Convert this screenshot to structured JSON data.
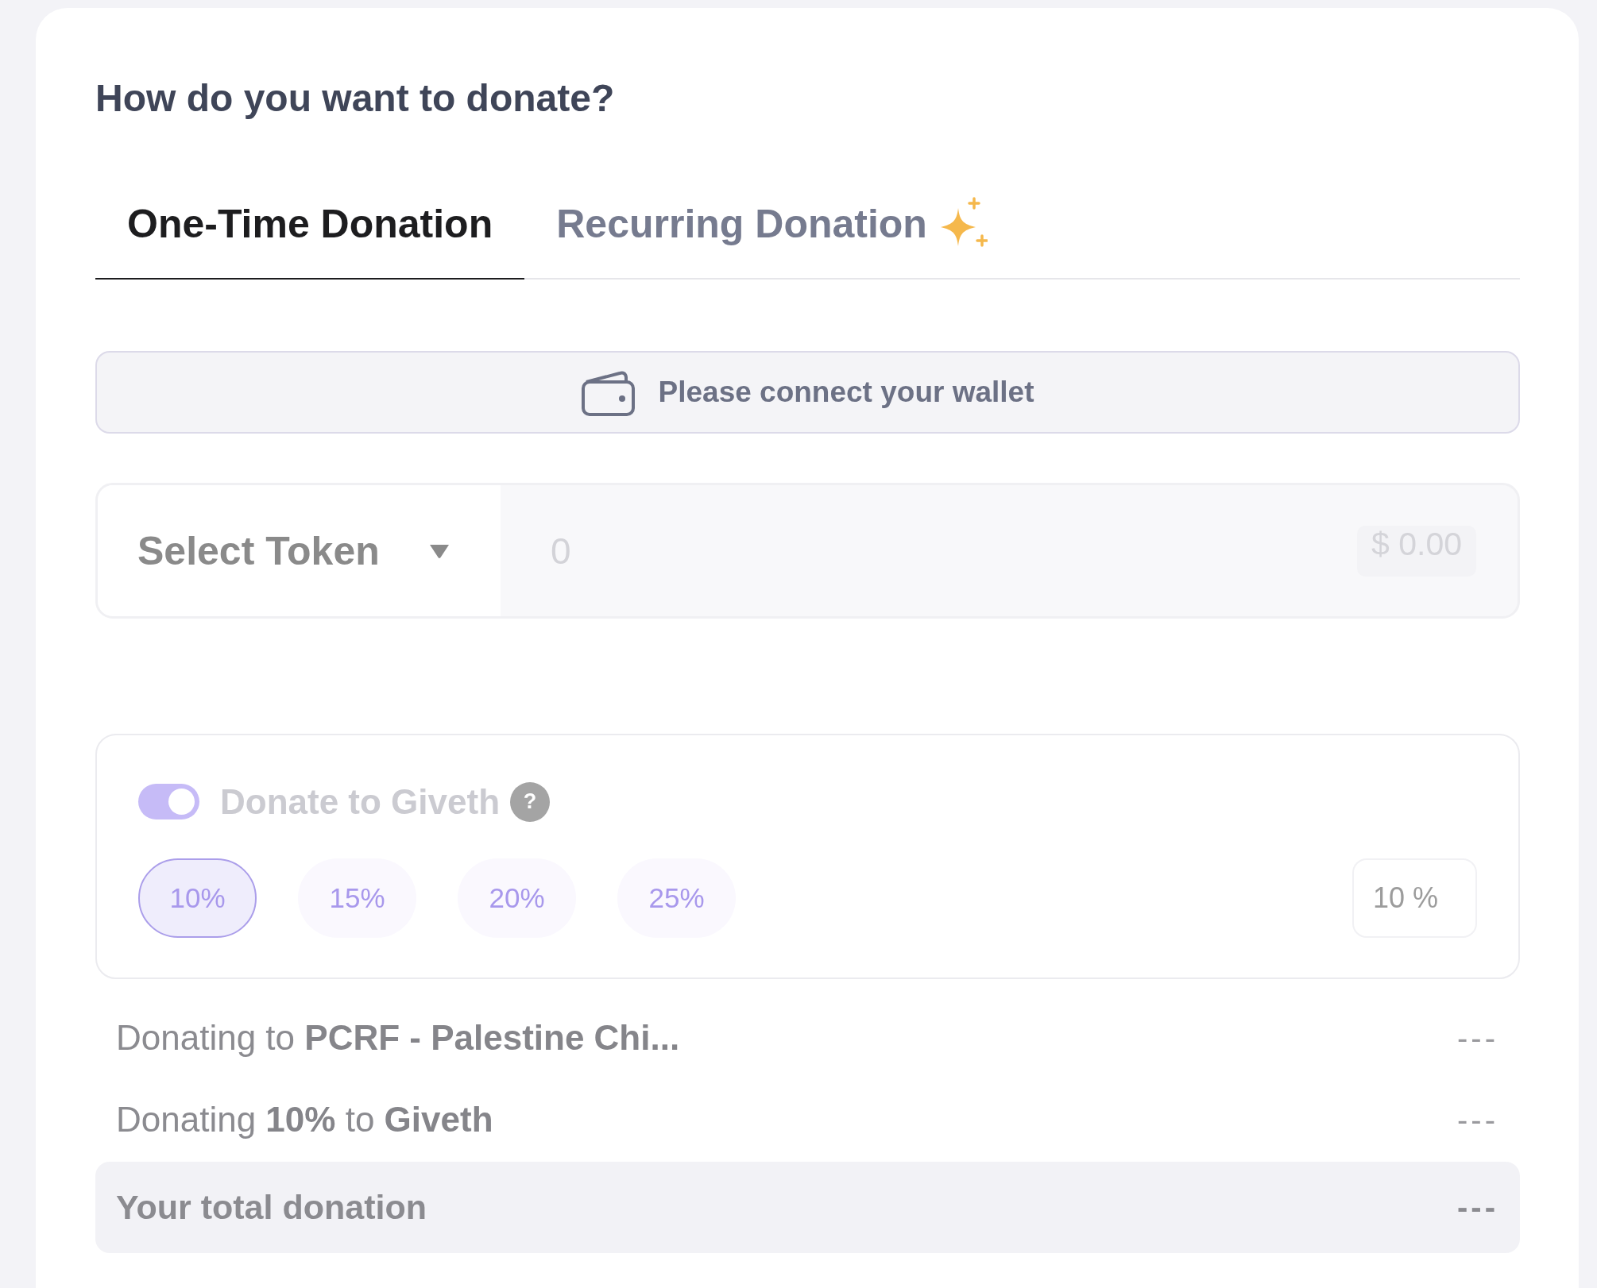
{
  "title": "How do you want to donate?",
  "tabs": [
    {
      "label": "One-Time Donation",
      "selected": true,
      "featured": false
    },
    {
      "label": "Recurring Donation",
      "selected": false,
      "featured": true
    }
  ],
  "wallet_button": {
    "label": "Please connect your wallet"
  },
  "amount": {
    "token_select": "Select Token",
    "amount_field": {
      "placeholder": "0"
    },
    "usd_value": "$ 0.00"
  },
  "giveth_support": {
    "toggle": {
      "label": "Donate to Giveth",
      "on": true
    },
    "help": "?",
    "options": [
      {
        "label": "10%",
        "selected": true
      },
      {
        "label": "15%",
        "selected": false
      },
      {
        "label": "20%",
        "selected": false
      },
      {
        "label": "25%",
        "selected": false
      }
    ],
    "custom_field": {
      "value": "10",
      "suffix": "%"
    }
  },
  "summary": {
    "rows": [
      {
        "label": "Donating to **PCRF - Palestine Chi...**",
        "value": "---"
      },
      {
        "label": "Donating **10%** to **Giveth**",
        "value": "---"
      }
    ],
    "total": {
      "label": "Your total donation",
      "value": "---"
    }
  }
}
